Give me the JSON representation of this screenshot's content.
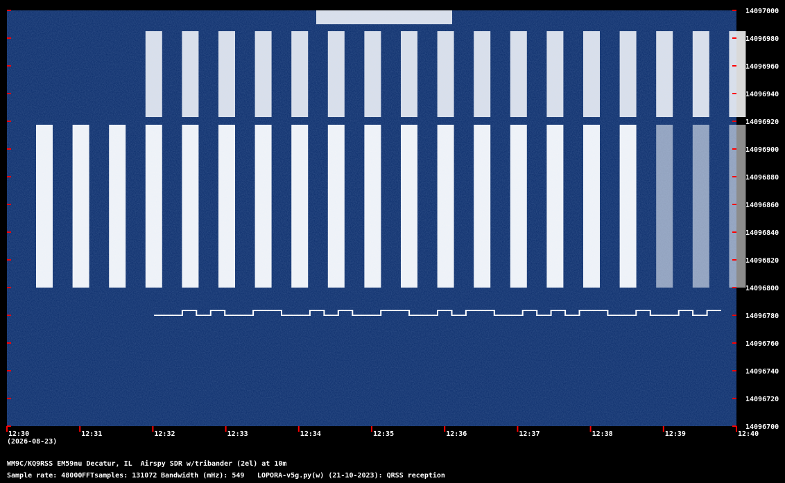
{
  "chart_data": {
    "type": "heatmap",
    "title": "",
    "xlabel": "",
    "ylabel": "",
    "x_ticks": [
      "12:30",
      "12:31",
      "12:32",
      "12:33",
      "12:34",
      "12:35",
      "12:36",
      "12:37",
      "12:38",
      "12:39",
      "12:40"
    ],
    "date_label": "(2026-08-23)",
    "y_ticks": [
      14097000,
      14096980,
      14096960,
      14096940,
      14096920,
      14096900,
      14096880,
      14096860,
      14096840,
      14096820,
      14096800,
      14096780,
      14096760,
      14096740,
      14096720,
      14096700
    ],
    "ylim": [
      14096700,
      14097000
    ],
    "colors": {
      "background": "#0b2d6b",
      "signal": "#ffffff",
      "tick": "#ff0000"
    },
    "strong_signal_bands_hz": [
      [
        14096800,
        14096920
      ]
    ],
    "weak_signal_bands_hz": [
      [
        14096920,
        14096985
      ]
    ],
    "fsk_trace_hz": 14096780
  },
  "footer": {
    "station": "WM9C/KQ9RSS EM59nu Decatur, IL  Airspy SDR w/tribander (2el) at 10m",
    "sample_rate": "Sample rate: 48000",
    "fft_samples": "FFTsamples: 131072",
    "bandwidth": "Bandwidth (mHz): 549",
    "software": "LOPORA-v5g.py(w) (21-10-2023): QRSS reception"
  }
}
